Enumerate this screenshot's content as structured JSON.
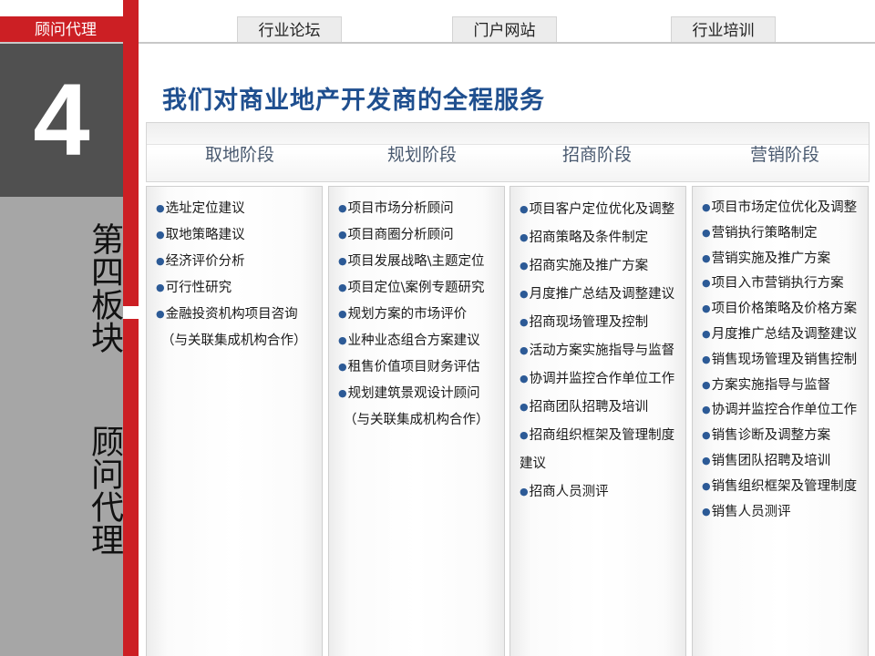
{
  "header": {
    "brand": "顾问代理",
    "nav": [
      "行业论坛",
      "门户网站",
      "行业培训"
    ]
  },
  "side": {
    "number": "4",
    "section": "第四板块",
    "topic": "顾问代理"
  },
  "main": {
    "title": "我们对商业地产开发商的全程服务",
    "phases": [
      "取地阶段",
      "规划阶段",
      "招商阶段",
      "营销阶段"
    ],
    "columns": [
      {
        "items": [
          "选址定位建议",
          "取地策略建议",
          "经济评价分析",
          "可行性研究",
          "金融投资机构项目咨询"
        ],
        "note": "（与关联集成机构合作）"
      },
      {
        "items": [
          "项目市场分析顾问",
          "项目商圈分析顾问",
          "项目发展战略\\主题定位",
          "项目定位\\案例专题研究",
          "规划方案的市场评价",
          "业种业态组合方案建议",
          "租售价值项目财务评估",
          "规划建筑景观设计顾问"
        ],
        "note": "（与关联集成机构合作）"
      },
      {
        "items": [
          "项目客户定位优化及调整",
          "招商策略及条件制定",
          "招商实施及推广方案",
          "月度推广总结及调整建议",
          "招商现场管理及控制",
          "活动方案实施指导与监督",
          "协调并监控合作单位工作",
          "招商团队招聘及培训",
          "招商组织框架及管理制度建议",
          "招商人员测评"
        ]
      },
      {
        "items": [
          "项目市场定位优化及调整",
          "营销执行策略制定",
          "营销实施及推广方案",
          "项目入市营销执行方案",
          "项目价格策略及价格方案",
          "月度推广总结及调整建议",
          "销售现场管理及销售控制",
          "方案实施指导与监督",
          "协调并监控合作单位工作",
          "销售诊断及调整方案",
          "销售团队招聘及培训",
          "销售组织框架及管理制度",
          "销售人员测评"
        ]
      }
    ]
  }
}
